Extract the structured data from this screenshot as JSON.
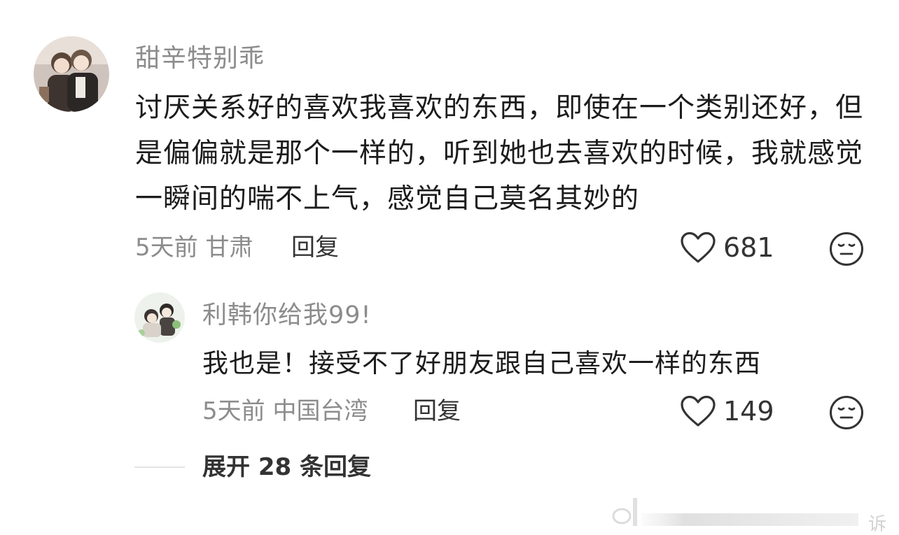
{
  "comments": [
    {
      "username": "甜辛特别乖",
      "avatar_icon": "avatar-anime-couple",
      "text": "讨厌关系好的喜欢我喜欢的东西，即使在一个类别还好，但是偏偏就是那个一样的，听到她也去喜欢的时候，我就感觉一瞬间的喘不上气，感觉自己莫名其妙的",
      "time": "5天前",
      "location": "甘肃",
      "reply_label": "回复",
      "likes": "681",
      "like_icon": "heart-outline-icon",
      "dislike_icon": "meh-face-icon",
      "replies": [
        {
          "username": "利韩你给我99!",
          "avatar_icon": "avatar-anime-characters",
          "text": "我也是！接受不了好朋友跟自己喜欢一样的东西",
          "time": "5天前",
          "location": "中国台湾",
          "reply_label": "回复",
          "likes": "149",
          "like_icon": "heart-outline-icon",
          "dislike_icon": "meh-face-icon"
        }
      ],
      "expand_label": "展开 28 条回复"
    }
  ],
  "watermark": {
    "icon": "weibo-watermark-icon",
    "text": "诉"
  },
  "colors": {
    "text": "#1c1c1c",
    "secondary": "#8c8c8c",
    "action": "#333333"
  }
}
